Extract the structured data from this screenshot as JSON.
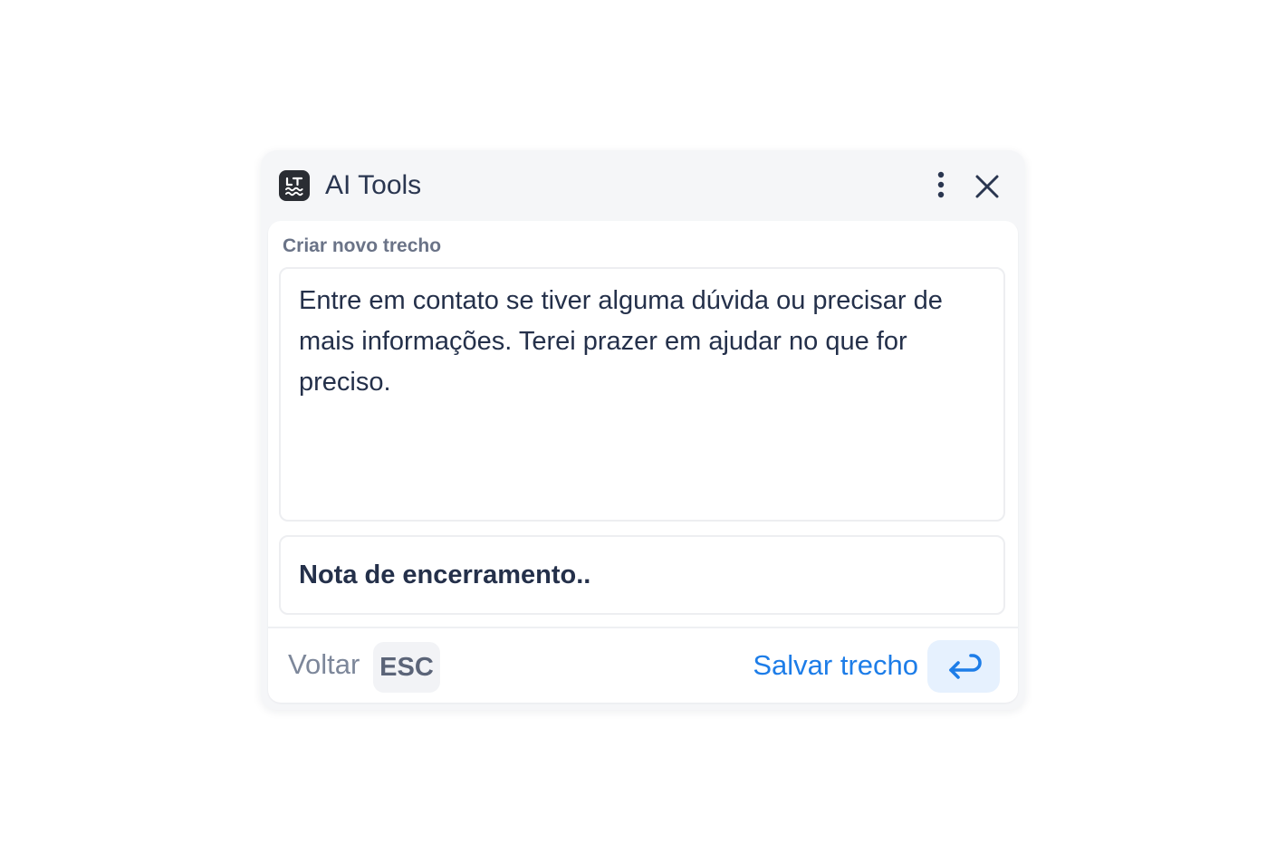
{
  "window": {
    "title": "AI Tools",
    "logo_icon": "lt-logo-icon",
    "menu_icon": "more-vertical-icon",
    "close_icon": "close-icon"
  },
  "form": {
    "section_label": "Criar novo trecho",
    "snippet_text": "Entre em contato se tiver alguma dúvida ou precisar de mais informações. Terei prazer em ajudar no que for preciso.",
    "note_value": "Nota de encerramento.."
  },
  "footer": {
    "back_label": "Voltar",
    "back_key": "ESC",
    "save_label": "Salvar trecho",
    "save_key_icon": "enter-return-icon"
  },
  "colors": {
    "accent": "#1d7de8",
    "accent_bg": "#e6f1fe",
    "text_primary": "#24304a",
    "text_muted": "#7d879a"
  }
}
